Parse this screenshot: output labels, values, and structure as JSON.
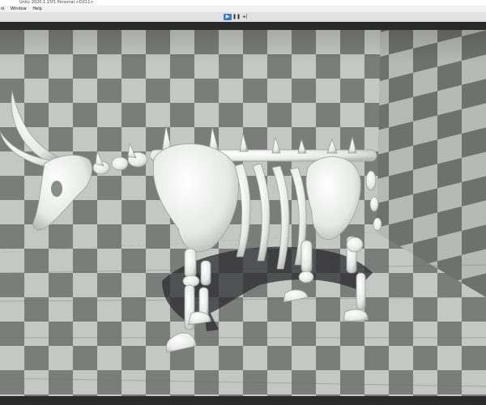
{
  "window": {
    "title": "Unity 2020.1.15f1 Personal <DX11>"
  },
  "menu": {
    "items": [
      "ol",
      "Window",
      "Help"
    ]
  },
  "toolbar": {
    "play_icon": "play-icon",
    "pause_icon": "pause-icon",
    "step_icon": "step-icon"
  },
  "scene": {
    "subject": "skeleton-creature",
    "environment": "checkered-room",
    "colors": {
      "light_tile": "#c4c7c3",
      "dark_tile": "#7b7d7a",
      "bone": "#eef0ee",
      "shadow": "#2b2b2f"
    }
  }
}
